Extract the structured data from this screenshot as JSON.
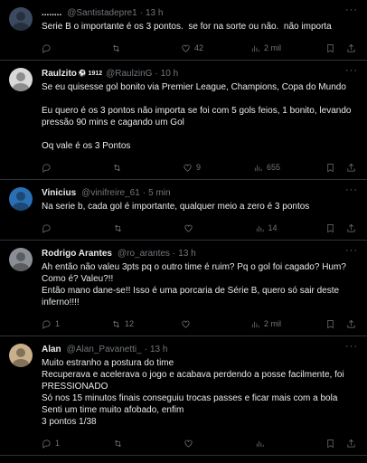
{
  "tweets": [
    {
      "name": "........",
      "badge": "",
      "handle": "@Santistadepre1",
      "time": "13 h",
      "text": "Serie B o importante é os 3 pontos.  se for na sorte ou não.  não importa",
      "replies": "",
      "retweets": "",
      "likes": "42",
      "views": "2 mil",
      "avatar_color": "#3b4a60"
    },
    {
      "name": "Raulzito",
      "badge": "⚽ 1912",
      "handle": "@RaulzinG",
      "time": "10 h",
      "text": "Se eu quisesse gol bonito via Premier League, Champions, Copa do Mundo\n\nEu quero é os 3 pontos não importa se foi com 5 gols feios, 1 bonito, levando pressão 90 mins e cagando um Gol\n\nOq vale é os 3 Pontos",
      "replies": "",
      "retweets": "",
      "likes": "9",
      "views": "655",
      "avatar_color": "#d9d9d9"
    },
    {
      "name": "Vinicius",
      "badge": "",
      "handle": "@vinifreire_61",
      "time": "5 min",
      "text": "Na serie b, cada gol é importante, qualquer meio a zero é 3 pontos",
      "replies": "",
      "retweets": "",
      "likes": "",
      "views": "14",
      "avatar_color": "#2a6fb3"
    },
    {
      "name": "Rodrigo Arantes",
      "badge": "",
      "handle": "@ro_arantes",
      "time": "13 h",
      "text": "Ah então não valeu 3pts pq o outro time é ruim? Pq o gol foi cagado? Hum? Como é? Valeu?!!\nEntão mano dane-se!! Isso é uma porcaria de Série B, quero só sair deste inferno!!!!",
      "replies": "1",
      "retweets": "12",
      "likes": "",
      "views": "2 mil",
      "avatar_color": "#8a8f96"
    },
    {
      "name": "Alan",
      "badge": "",
      "handle": "@Alan_Pavanetti_",
      "time": "13 h",
      "text": "Muito estranho a postura do time\nRecuperava e acelerava o jogo e acabava perdendo a posse facilmente, foi PRESSIONADO\nSó nos 15 minutos finais conseguiu trocas passes e ficar mais com a bola\nSenti um time muito afobado, enfim\n3 pontos 1/38",
      "replies": "1",
      "retweets": "",
      "likes": "",
      "views": "",
      "avatar_color": "#c9b08a"
    }
  ]
}
